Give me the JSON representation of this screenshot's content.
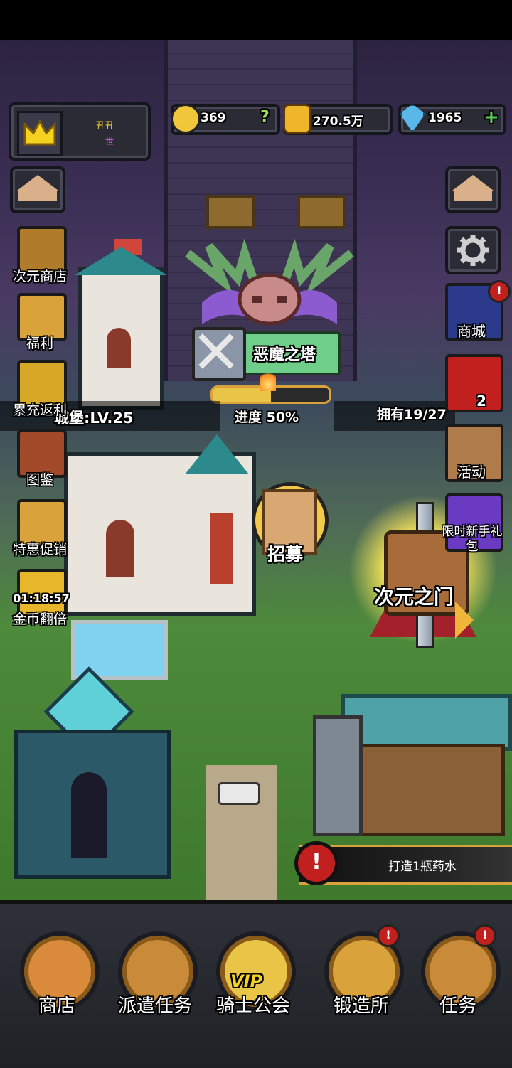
{
  "profile": {
    "name": "丑丑",
    "title": "一世"
  },
  "resources": {
    "medals": "369",
    "medals_help": "?",
    "gold": "270.5万",
    "gems": "1965",
    "gems_add": "+"
  },
  "left_menu": [
    {
      "label": "次元商店",
      "icon": "treasure-chest-icon"
    },
    {
      "label": "福利",
      "icon": "gift-chest-icon"
    },
    {
      "label": "累充返利",
      "icon": "golden-chest-icon"
    },
    {
      "label": "图鉴",
      "icon": "book-icon"
    },
    {
      "label": "特惠促销",
      "icon": "sale-chest-icon"
    },
    {
      "label": "金币翻倍",
      "icon": "gold-double-icon",
      "timer": "01:18:57"
    }
  ],
  "right_menu": [
    {
      "label": "商城",
      "icon": "mall-icon"
    },
    {
      "label": "",
      "icon": "gift-box-icon",
      "count": "2"
    },
    {
      "label": "活动",
      "icon": "scroll-icon"
    },
    {
      "label": "限时新手礼包",
      "icon": "newbie-gift-icon"
    }
  ],
  "tower": {
    "name": "恶魔之塔",
    "progress_label": "进度 50%",
    "progress": 0.5
  },
  "castle": {
    "level_text": "城堡:LV.25"
  },
  "portal": {
    "label": "次元之门",
    "owned_text": "拥有19/27"
  },
  "recruit": {
    "label": "招募"
  },
  "quest_banner": {
    "text": "打造1瓶药水"
  },
  "bottom_nav": [
    {
      "label": "商店",
      "icon": "shop-icon",
      "badge": false
    },
    {
      "label": "派遣任务",
      "icon": "dispatch-icon",
      "badge": false
    },
    {
      "label": "骑士公会",
      "icon": "knight-guild-icon",
      "badge": false,
      "vip": "VIP"
    },
    {
      "label": "锻造所",
      "icon": "forge-icon",
      "badge": true
    },
    {
      "label": "任务",
      "icon": "quest-icon",
      "badge": true
    }
  ],
  "badge_symbol": "!",
  "colors": {
    "accent": "#d9a23a",
    "panel": "#2b2b36",
    "alert": "#c21f1f",
    "tower_label_bg": "#6fcf8a"
  }
}
